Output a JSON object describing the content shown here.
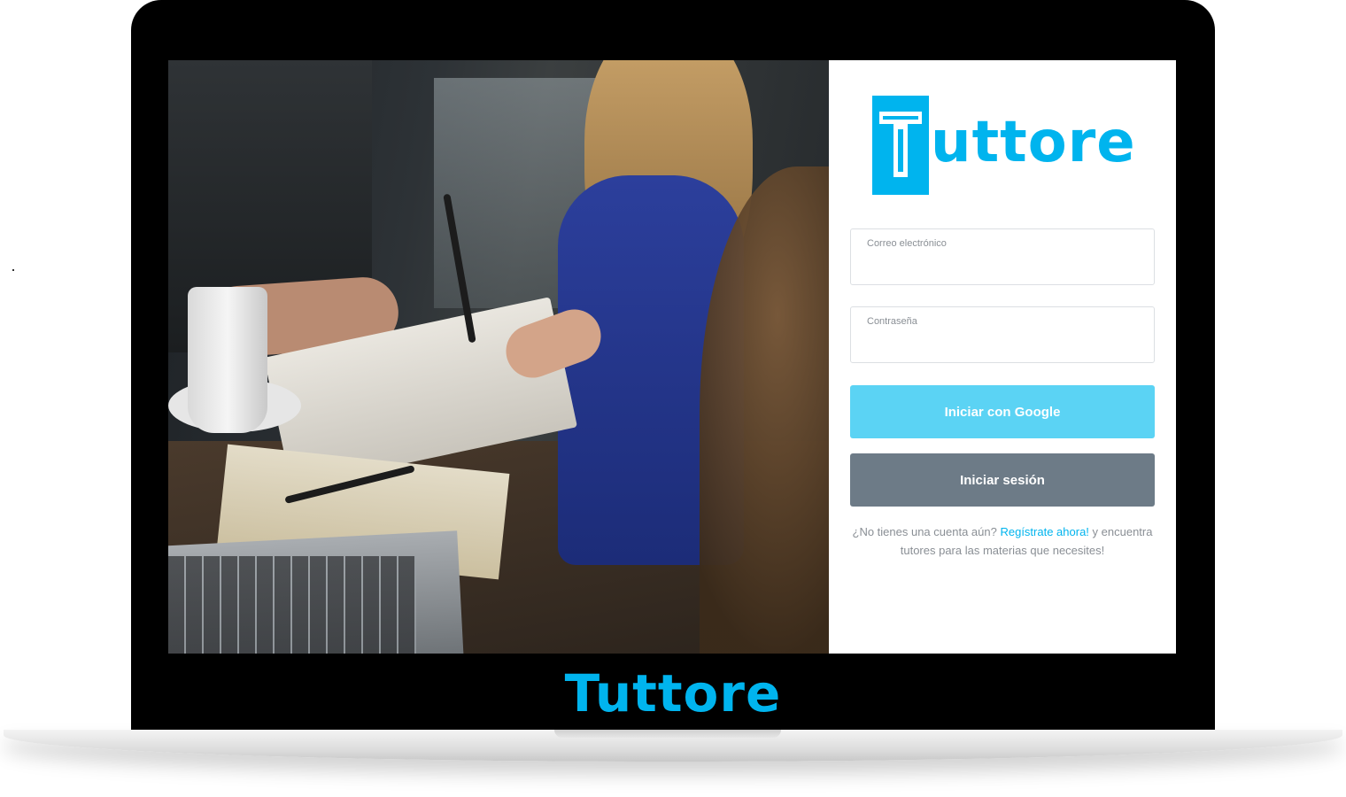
{
  "app": {
    "logo_text": "uttore",
    "caption": "Tuttore",
    "brand_color": "#00b4ee"
  },
  "login": {
    "email_label": "Correo electrónico",
    "email_value": "",
    "password_label": "Contraseña",
    "password_value": "",
    "google_button": "Iniciar con Google",
    "login_button": "Iniciar sesión",
    "signup_prefix": "¿No tienes una cuenta aún?",
    "signup_link": "Regístrate ahora!",
    "signup_suffix": "y encuentra tutores para las materias que necesites!",
    "google_color": "#5bd3f4",
    "login_color": "#6d7b87"
  }
}
